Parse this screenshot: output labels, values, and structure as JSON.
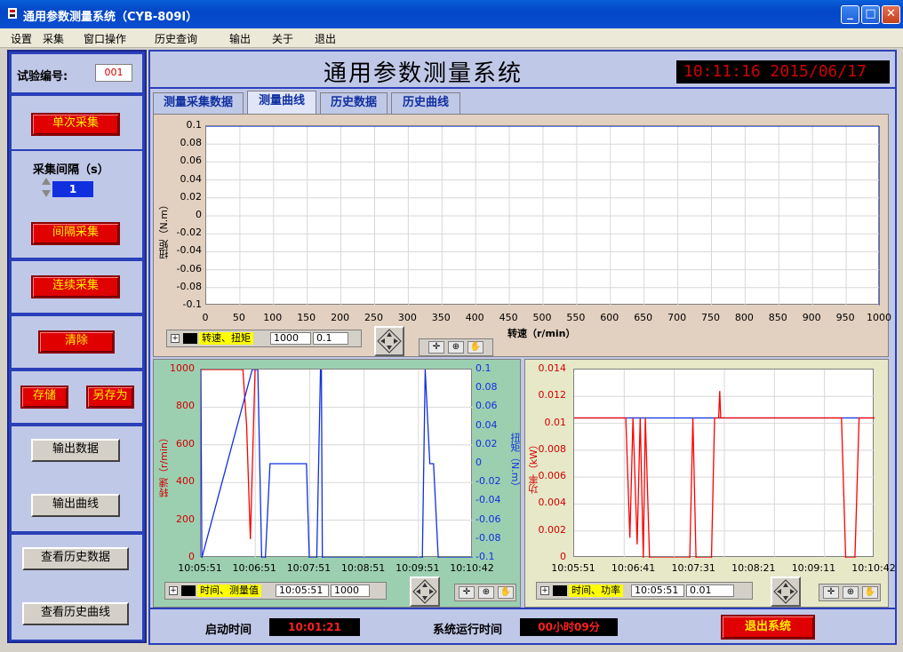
{
  "window": {
    "title": "通用参数测量系统（CYB-809I）"
  },
  "menu": {
    "items": [
      "设置",
      "采集",
      "窗口操作",
      "历史查询",
      "输出",
      "关于",
      "退出"
    ]
  },
  "left": {
    "test_no_label": "试验编号:",
    "test_no_value": "001",
    "single_btn": "单次采集",
    "interval_label": "采集间隔（s）",
    "interval_value": "1",
    "interval_btn": "间隔采集",
    "continuous_btn": "连续采集",
    "clear_btn": "清除",
    "save_btn": "存储",
    "save_as_btn": "另存为",
    "export_data_btn": "输出数据",
    "export_curve_btn": "输出曲线",
    "history_data_btn": "查看历史数据",
    "history_curve_btn": "查看历史曲线"
  },
  "header": {
    "title": "通用参数测量系统",
    "clock": "10:11:16  2015/06/17"
  },
  "tabs": [
    "测量采集数据",
    "测量曲线",
    "历史数据",
    "历史曲线"
  ],
  "active_tab": 1,
  "legends": {
    "top": {
      "label": "转速、扭矩",
      "f1": "1000",
      "f2": "0.1"
    },
    "bl": {
      "label": "时间、测量值",
      "f1": "10:05:51",
      "f2": "1000"
    },
    "br": {
      "label": "时间、功率",
      "f1": "10:05:51",
      "f2": "0.01"
    }
  },
  "footer": {
    "start_label": "启动时间",
    "start_value": "10:01:21",
    "run_label": "系统运行时间",
    "run_value": "00小时09分",
    "exit_btn": "退出系统"
  },
  "colors": {
    "red_series": "#ff0000",
    "blue_series": "#1030e0",
    "top_panel_bg": "#e2d0c0",
    "bl_panel_bg": "#9ccfb0",
    "br_panel_bg": "#e6e8c8"
  },
  "chart_data": [
    {
      "type": "line",
      "title": "",
      "xlabel": "转速（r/min）",
      "ylabel": "扭矩（N.m）",
      "xlim": [
        0,
        1000
      ],
      "ylim": [
        -0.1,
        0.1
      ],
      "xticks": [
        "0",
        "50",
        "100",
        "150",
        "200",
        "250",
        "300",
        "350",
        "400",
        "450",
        "500",
        "550",
        "600",
        "650",
        "700",
        "750",
        "800",
        "850",
        "900",
        "950",
        "1000"
      ],
      "yticks": [
        "0.1",
        "0.08",
        "0.06",
        "0.04",
        "0.02",
        "0",
        "-0.02",
        "-0.04",
        "-0.06",
        "-0.08",
        "-0.1"
      ],
      "series": [
        {
          "color": "#1030e0",
          "points": [
            [
              0,
              0.1
            ],
            [
              1000,
              0.1
            ],
            [
              1000,
              -0.1
            ]
          ]
        }
      ],
      "grid": true
    },
    {
      "type": "line",
      "title": "",
      "xlabel": "",
      "ylabel": "转速（r/min）",
      "ylabel_right": "扭矩（N.m）",
      "xlim": [
        "10:05:51",
        "10:10:42"
      ],
      "xticks": [
        "10:05:51",
        "10:06:51",
        "10:07:51",
        "10:08:51",
        "10:09:51",
        "10:10:42"
      ],
      "ylim": [
        0,
        1000
      ],
      "yticks": [
        "1000",
        "800",
        "600",
        "400",
        "200",
        "0"
      ],
      "ylim_right": [
        -0.1,
        0.1
      ],
      "yticks_right": [
        "0.1",
        "0.08",
        "0.06",
        "0.04",
        "0.02",
        "0",
        "-0.02",
        "-0.04",
        "-0.06",
        "-0.08",
        "-0.1"
      ],
      "series": [
        {
          "color": "#ff0000",
          "axis": "left",
          "points": [
            [
              "10:05:51",
              1000
            ],
            [
              "10:06:36",
              1000
            ],
            [
              "10:06:40",
              700
            ],
            [
              "10:06:44",
              100
            ],
            [
              "10:06:49",
              1000
            ],
            [
              "10:06:52",
              1000
            ]
          ]
        },
        {
          "color": "#1030e0",
          "axis": "left",
          "points": [
            [
              "10:05:51",
              1000
            ],
            [
              "10:05:52",
              0
            ],
            [
              "10:06:46",
              1000
            ],
            [
              "10:06:52",
              1000
            ],
            [
              "10:06:56",
              0
            ],
            [
              "10:07:00",
              0
            ],
            [
              "10:07:05",
              500
            ],
            [
              "10:07:44",
              500
            ],
            [
              "10:07:47",
              0
            ],
            [
              "10:07:55",
              0
            ],
            [
              "10:07:59",
              1000
            ],
            [
              "10:08:00",
              1000
            ],
            [
              "10:08:01",
              0
            ],
            [
              "10:09:48",
              0
            ],
            [
              "10:09:51",
              1000
            ],
            [
              "10:09:56",
              500
            ],
            [
              "10:10:00",
              500
            ],
            [
              "10:10:05",
              0
            ],
            [
              "10:10:42",
              0
            ]
          ]
        }
      ],
      "grid": true
    },
    {
      "type": "line",
      "title": "",
      "xlabel": "",
      "ylabel": "功率（kW）",
      "xlim": [
        "10:05:51",
        "10:10:42"
      ],
      "xticks": [
        "10:05:51",
        "10:06:41",
        "10:07:31",
        "10:08:21",
        "10:09:11",
        "10:10:42"
      ],
      "ylim": [
        0,
        0.014
      ],
      "yticks": [
        "0.014",
        "0.012",
        "0.01",
        "0.008",
        "0.006",
        "0.004",
        "0.002",
        "0"
      ],
      "series": [
        {
          "color": "#1030e0",
          "points": [
            [
              "10:05:51",
              0.0104
            ],
            [
              "10:10:42",
              0.0104
            ]
          ]
        },
        {
          "color": "#ff0000",
          "points": [
            [
              "10:05:51",
              0.0104
            ],
            [
              "10:06:41",
              0.0104
            ],
            [
              "10:06:45",
              0.0015
            ],
            [
              "10:06:48",
              0.0104
            ],
            [
              "10:06:52",
              0.001
            ],
            [
              "10:06:55",
              0.0104
            ],
            [
              "10:06:58",
              0
            ],
            [
              "10:07:00",
              0.0104
            ],
            [
              "10:07:04",
              0
            ],
            [
              "10:07:43",
              0
            ],
            [
              "10:07:46",
              0.0104
            ],
            [
              "10:07:49",
              0
            ],
            [
              "10:08:04",
              0
            ],
            [
              "10:08:07",
              0.0104
            ],
            [
              "10:08:11",
              0.0104
            ],
            [
              "10:08:12",
              0.0124
            ],
            [
              "10:08:13",
              0.0104
            ],
            [
              "10:10:10",
              0.0104
            ],
            [
              "10:10:14",
              0
            ],
            [
              "10:10:23",
              0
            ],
            [
              "10:10:27",
              0.0104
            ],
            [
              "10:10:42",
              0.0104
            ]
          ]
        }
      ],
      "grid": true
    }
  ]
}
